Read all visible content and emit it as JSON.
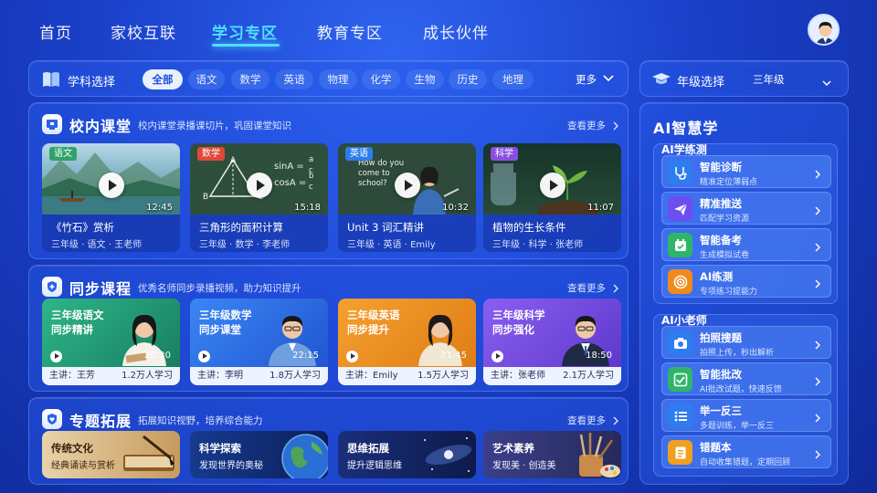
{
  "nav": {
    "items": [
      "首页",
      "家校互联",
      "学习专区",
      "教育专区",
      "成长伙伴"
    ],
    "active": "学习专区"
  },
  "subject_bar": {
    "title": "学科选择",
    "chips": [
      "全部",
      "语文",
      "数学",
      "英语",
      "物理",
      "化学",
      "生物",
      "历史",
      "地理"
    ],
    "active": "全部",
    "more": "更多"
  },
  "grade": {
    "label": "年级选择",
    "value": "三年级"
  },
  "in_class": {
    "title": "校内课堂",
    "subtitle": "校内课堂录播课切片，巩固课堂知识",
    "more": "查看更多",
    "cards": [
      {
        "tag": "语文",
        "duration": "12:45",
        "title": "《竹石》赏析",
        "meta": "三年级 · 语文 · 王老师"
      },
      {
        "tag": "数学",
        "duration": "15:18",
        "title": "三角形的面积计算",
        "meta": "三年级 · 数学 · 李老师"
      },
      {
        "tag": "英语",
        "duration": "10:32",
        "title": "Unit 3 词汇精讲",
        "meta": "三年级 · 英语 · Emily"
      },
      {
        "tag": "科学",
        "duration": "11:07",
        "title": "植物的生长条件",
        "meta": "三年级 · 科学 · 张老师"
      }
    ],
    "board": {
      "eq1": "sinA =",
      "eq2": "cosA =",
      "va": "a",
      "vb": "b",
      "vc": "c",
      "pa": "A",
      "pb": "B",
      "pc": "C",
      "speech": "How do you come to school?"
    }
  },
  "sync": {
    "title": "同步课程",
    "subtitle": "优秀名师同步录播视频，助力知识提升",
    "more": "查看更多",
    "cards": [
      {
        "t1": "三年级语文",
        "t2": "同步精讲",
        "duration": "20:30",
        "teacher": "主讲：王芳",
        "count": "1.2万人学习"
      },
      {
        "t1": "三年级数学",
        "t2": "同步课堂",
        "duration": "22:15",
        "teacher": "主讲：李明",
        "count": "1.8万人学习"
      },
      {
        "t1": "三年级英语",
        "t2": "同步提升",
        "duration": "21:45",
        "teacher": "主讲：Emily",
        "count": "1.5万人学习"
      },
      {
        "t1": "三年级科学",
        "t2": "同步强化",
        "duration": "18:50",
        "teacher": "主讲：张老师",
        "count": "2.1万人学习"
      }
    ]
  },
  "topics": {
    "title": "专题拓展",
    "subtitle": "拓展知识视野，培养综合能力",
    "more": "查看更多",
    "cards": [
      {
        "t1": "传统文化",
        "t2": "经典诵读与赏析"
      },
      {
        "t1": "科学探索",
        "t2": "发现世界的奥秘"
      },
      {
        "t1": "思维拓展",
        "t2": "提升逻辑思维"
      },
      {
        "t1": "艺术素养",
        "t2": "发现美 · 创造美"
      }
    ]
  },
  "ai": {
    "title": "AI智慧学",
    "practice": {
      "title": "AI学练测",
      "items": [
        {
          "name": "智能诊断",
          "desc": "精准定位薄弱点",
          "icon": "stethoscope-icon"
        },
        {
          "name": "精准推送",
          "desc": "匹配学习资源",
          "icon": "paper-plane-icon"
        },
        {
          "name": "智能备考",
          "desc": "生成模拟试卷",
          "icon": "calendar-check-icon"
        },
        {
          "name": "AI练测",
          "desc": "专项练习提能力",
          "icon": "target-icon"
        }
      ]
    },
    "teacher": {
      "title": "AI小老师",
      "items": [
        {
          "name": "拍照搜题",
          "desc": "拍照上传，秒出解析",
          "icon": "camera-icon"
        },
        {
          "name": "智能批改",
          "desc": "AI批改试题，快速反馈",
          "icon": "check-square-icon"
        },
        {
          "name": "举一反三",
          "desc": "多题训练，举一反三",
          "icon": "list-icon"
        },
        {
          "name": "错题本",
          "desc": "自动收集错题，定期回顾",
          "icon": "notebook-icon"
        }
      ]
    }
  },
  "colors": {
    "accent": "#4fe0ff",
    "bg": "#1a3fc8",
    "tag_yuwen": "#2fa36b",
    "tag_shuxue": "#e0483a",
    "tag_yingyu": "#2b7de9",
    "tag_kexue": "#8a4fe0"
  }
}
